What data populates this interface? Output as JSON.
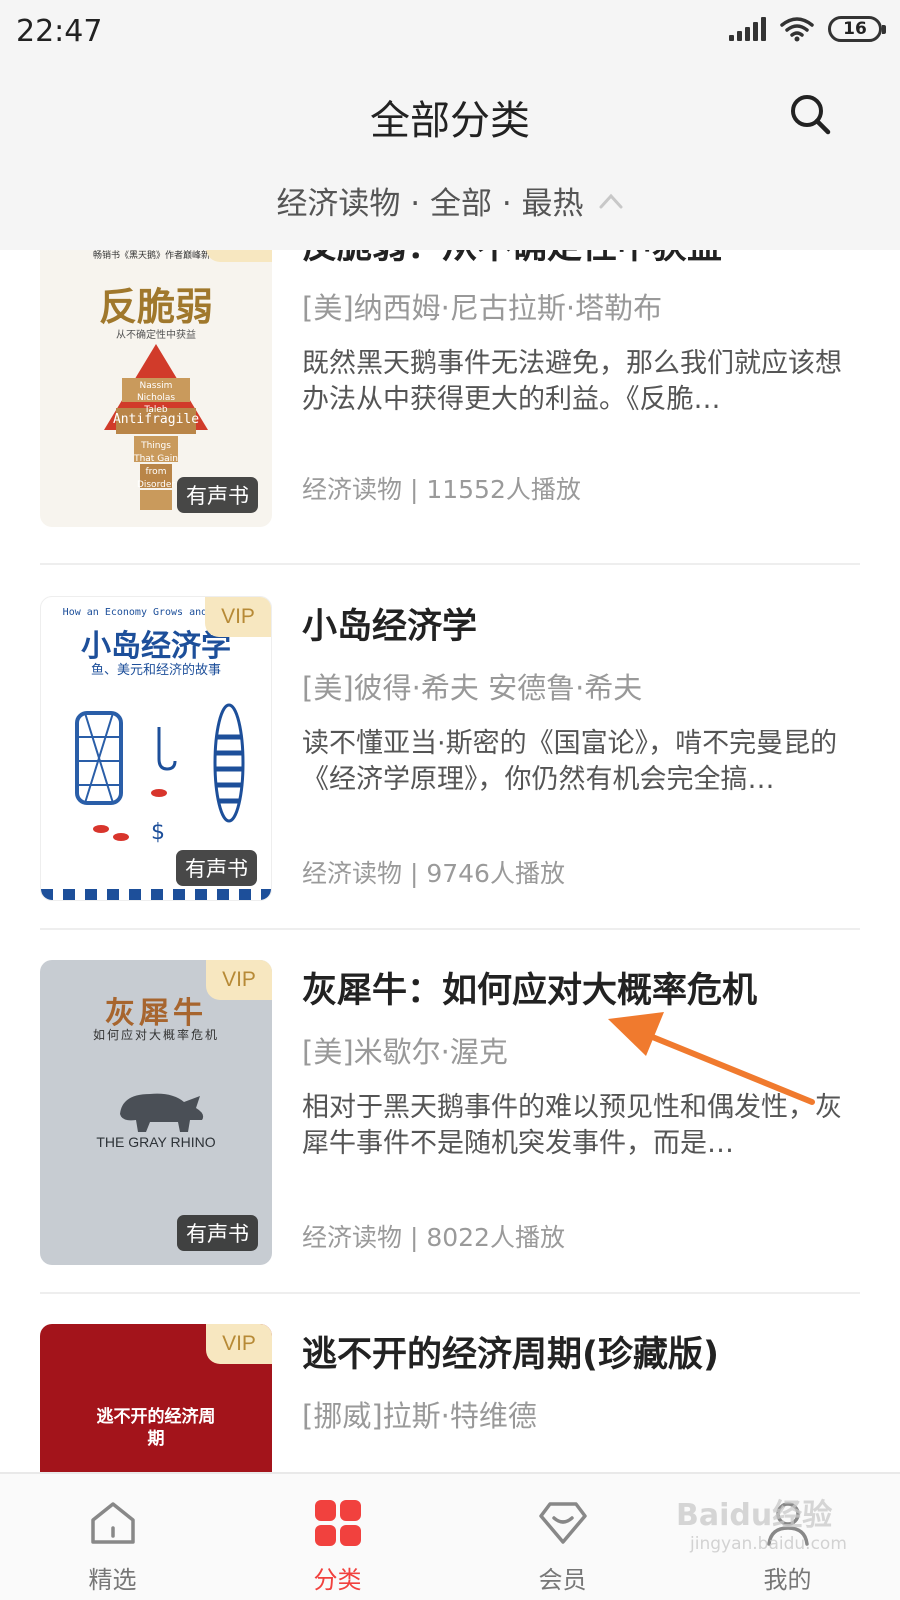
{
  "status": {
    "time": "22:47",
    "battery": "16"
  },
  "header": {
    "title": "全部分类",
    "filter": "经济读物 · 全部 · 最热"
  },
  "icons": {
    "search": "search-icon",
    "expand": "chevron-up-icon"
  },
  "colors": {
    "accent": "#f1413e",
    "vip_bg": "#f7e7c0",
    "vip_text": "#b78a36",
    "arrow": "#f07a2e"
  },
  "books": [
    {
      "vip": "VIP",
      "badge": "有声书",
      "title": "反脆弱：从不确定性中获益",
      "author": "[美]纳西姆·尼古拉斯·塔勒布",
      "desc": "既然黑天鹅事件无法避免，那么我们就应该想办法从中获得更大的利益。《反脆…",
      "meta": "经济读物 | 11552人播放",
      "cover": {
        "top": "畅销书《黑天鹅》作者巅峰新作",
        "title": "反脆弱",
        "subtitle": "从不确定性中获益",
        "en": "Antifragile",
        "en_author": "Nassim Nicholas Taleb",
        "en_words": "Things That Gain from Disorder"
      }
    },
    {
      "vip": "VIP",
      "badge": "有声书",
      "title": "小岛经济学",
      "author": "[美]彼得·希夫 安德鲁·希夫",
      "desc": "读不懂亚当·斯密的《国富论》，啃不完曼昆的《经济学原理》，你仍然有机会完全搞…",
      "meta": "经济读物 | 9746人播放",
      "cover": {
        "top": "How an Economy Grows and Why It",
        "title": "小岛经济学",
        "subtitle": "鱼、美元和经济的故事"
      }
    },
    {
      "vip": "VIP",
      "badge": "有声书",
      "title": "灰犀牛：如何应对大概率危机",
      "author": "[美]米歇尔·渥克",
      "desc": "相对于黑天鹅事件的难以预见性和偶发性，灰犀牛事件不是随机突发事件，而是…",
      "meta": "经济读物 | 8022人播放",
      "cover": {
        "title": "灰犀牛",
        "subtitle": "如何应对大概率危机",
        "en": "THE GRAY RHINO"
      }
    },
    {
      "vip": "VIP",
      "title": "逃不开的经济周期(珍藏版)",
      "author": "[挪威]拉斯·特维德",
      "cover": {
        "title": "逃不开的经济周期"
      }
    }
  ],
  "nav": [
    {
      "label": "精选",
      "icon": "home-icon"
    },
    {
      "label": "分类",
      "icon": "grid-icon"
    },
    {
      "label": "会员",
      "icon": "diamond-icon"
    },
    {
      "label": "我的",
      "icon": "person-icon"
    }
  ],
  "watermark": {
    "logo": "Baidu经验",
    "url": "jingyan.baidu.com"
  }
}
